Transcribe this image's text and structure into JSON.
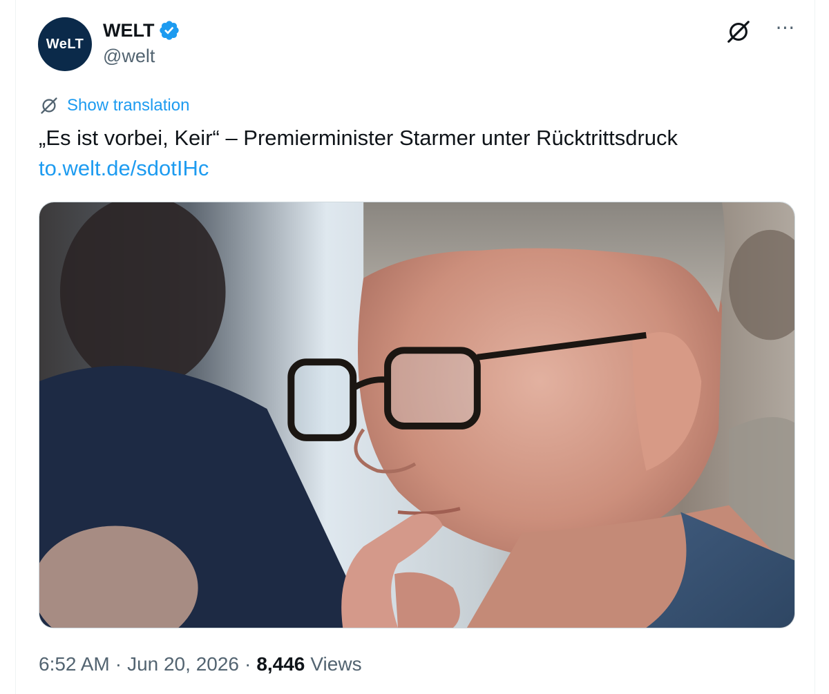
{
  "account": {
    "display_name": "WELT",
    "handle": "@welt",
    "avatar_text": "WeLT",
    "verified": true
  },
  "translation": {
    "label": "Show translation"
  },
  "tweet": {
    "text": "„Es ist vorbei, Keir“ – Premierminister Starmer unter Rücktrittsdruck",
    "link": "to.welt.de/sdotIHc"
  },
  "media": {
    "description_alt": "Photo of a man with glasses resting his chin on his hand"
  },
  "meta": {
    "time": "6:52 AM",
    "date": "Jun 20, 2026",
    "views_count": "8,446",
    "views_label": "Views",
    "separator": "·"
  },
  "icons": {
    "verified": "verified-badge-icon",
    "grok": "grok-icon",
    "more": "more-icon",
    "translate": "translate-icon"
  },
  "colors": {
    "accent": "#1d9bf0",
    "secondary_text": "#536471",
    "primary_text": "#0f1419",
    "avatar_bg": "#0b2a4a"
  }
}
